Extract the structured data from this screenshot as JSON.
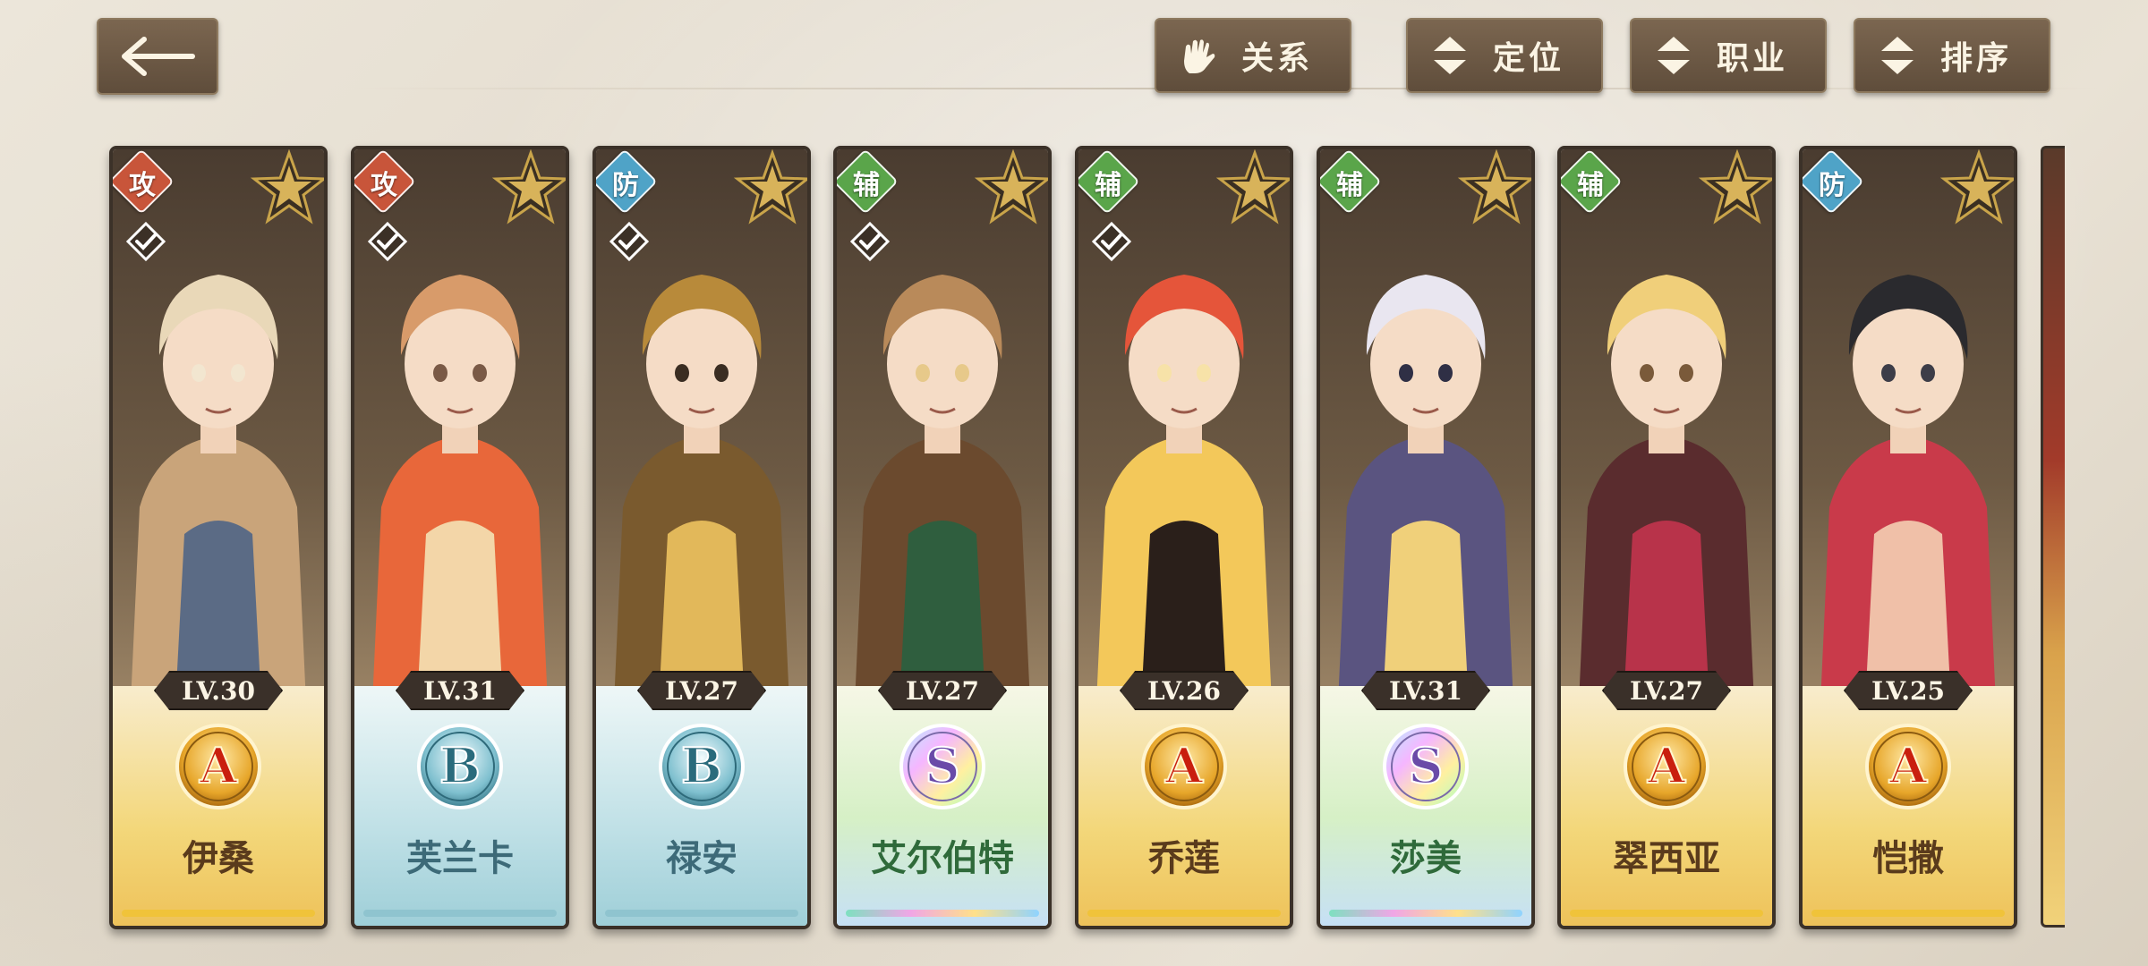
{
  "toolbar": {
    "back_icon": "back-arrow-icon",
    "buttons": [
      {
        "label": "关系",
        "icon": "gauntlet-icon"
      },
      {
        "label": "定位",
        "icon": "sort-toggle-icon"
      },
      {
        "label": "职业",
        "icon": "sort-toggle-icon"
      },
      {
        "label": "排序",
        "icon": "sort-toggle-icon"
      }
    ]
  },
  "colors": {
    "attack": "#c8553a",
    "defense": "#4fa3c7",
    "support": "#5aa54a",
    "gold_bg": "#f3d77a",
    "blue_bg": "#bfe0e6",
    "rainbow_bg": "#d6f0c6",
    "name_gold": "#5a3b1c",
    "name_blue": "#3d6a78",
    "name_green": "#2f6a3a"
  },
  "heroes": [
    {
      "role": "攻",
      "level": "LV.30",
      "grade": "A",
      "name": "伊桑"
    },
    {
      "role": "攻",
      "level": "LV.31",
      "grade": "B",
      "name": "芙兰卡"
    },
    {
      "role": "防",
      "level": "LV.27",
      "grade": "B",
      "name": "禄安"
    },
    {
      "role": "辅",
      "level": "LV.27",
      "grade": "S",
      "name": "艾尔伯特"
    },
    {
      "role": "辅",
      "level": "LV.26",
      "grade": "A",
      "name": "乔莲"
    },
    {
      "role": "辅",
      "level": "LV.31",
      "grade": "S",
      "name": "莎美"
    },
    {
      "role": "辅",
      "level": "LV.27",
      "grade": "A",
      "name": "翠西亚"
    },
    {
      "role": "防",
      "level": "LV.25",
      "grade": "A",
      "name": "恺撒"
    }
  ]
}
